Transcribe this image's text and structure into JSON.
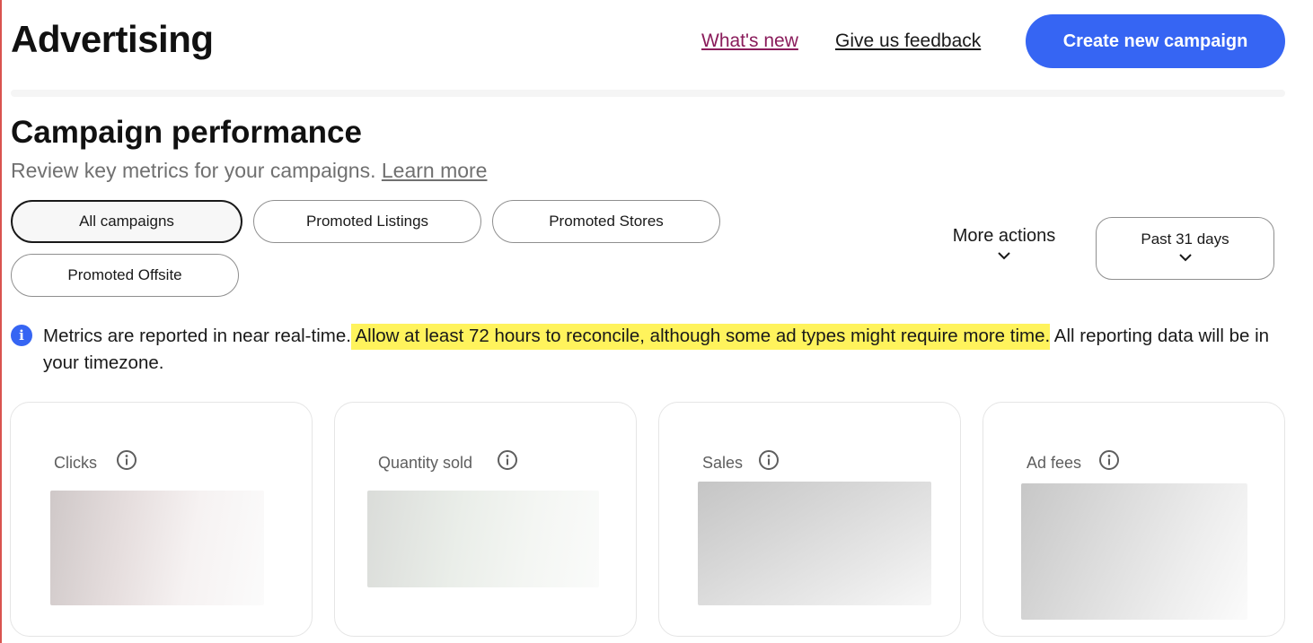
{
  "header": {
    "title": "Advertising",
    "whats_new_label": "What's new",
    "feedback_label": "Give us feedback",
    "create_button_label": "Create new campaign"
  },
  "campaign_performance": {
    "title": "Campaign performance",
    "subtitle": "Review key metrics for your campaigns.",
    "learn_more_label": "Learn more"
  },
  "filters": {
    "chips": [
      {
        "label": "All campaigns",
        "selected": true
      },
      {
        "label": "Promoted Listings",
        "selected": false
      },
      {
        "label": "Promoted Stores",
        "selected": false
      },
      {
        "label": "Promoted Offsite",
        "selected": false
      }
    ],
    "more_actions_label": "More actions",
    "date_range_label": "Past 31 days"
  },
  "notice": {
    "icon": "info-icon",
    "text_before": "Metrics are reported in near real-time.",
    "text_highlight": " Allow at least 72 hours to reconcile, although some ad types might require more time.",
    "text_after": " All reporting data will be in your timezone."
  },
  "metrics": [
    {
      "label": "Clicks",
      "icon": "info-icon"
    },
    {
      "label": "Quantity sold",
      "icon": "info-icon"
    },
    {
      "label": "Sales",
      "icon": "info-icon"
    },
    {
      "label": "Ad fees",
      "icon": "info-icon"
    }
  ],
  "colors": {
    "primary_button": "#3665f3",
    "whats_new_link": "#8a1c5b",
    "highlight": "#fff35c",
    "info_icon": "#3665f3"
  }
}
